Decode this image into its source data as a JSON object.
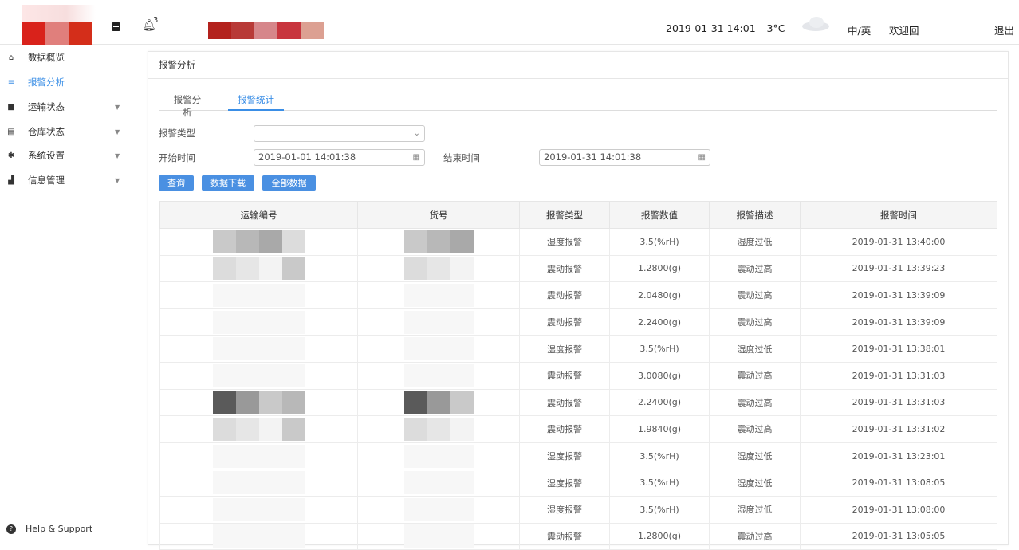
{
  "header": {
    "notification_count": "3",
    "datetime": "2019-01-31 14:01",
    "temperature": "-3°C",
    "lang_switch": "中/英",
    "welcome": "欢迎回",
    "logout": "退出"
  },
  "sidebar": {
    "items": [
      {
        "label": "数据概览",
        "icon": "home-icon",
        "glyph": "⌂",
        "active": false,
        "expandable": false
      },
      {
        "label": "报警分析",
        "icon": "list-icon",
        "glyph": "≡",
        "active": true,
        "expandable": false
      },
      {
        "label": "运输状态",
        "icon": "truck-icon",
        "glyph": "■",
        "active": false,
        "expandable": true
      },
      {
        "label": "仓库状态",
        "icon": "warehouse-icon",
        "glyph": "▤",
        "active": false,
        "expandable": true
      },
      {
        "label": "系统设置",
        "icon": "gear-icon",
        "glyph": "✱",
        "active": false,
        "expandable": true
      },
      {
        "label": "信息管理",
        "icon": "info-icon",
        "glyph": "▟",
        "active": false,
        "expandable": true
      }
    ],
    "help_label": "Help & Support"
  },
  "panel": {
    "title": "报警分析",
    "tabs": [
      {
        "label": "报警分析",
        "active": false
      },
      {
        "label": "报警统计",
        "active": true
      }
    ],
    "form": {
      "alarm_type_label": "报警类型",
      "alarm_type_value": "",
      "start_label": "开始时间",
      "start_value": "2019-01-01 14:01:38",
      "end_label": "结束时间",
      "end_value": "2019-01-31 14:01:38"
    },
    "buttons": {
      "query": "查询",
      "download": "数据下载",
      "all": "全部数据"
    },
    "table": {
      "columns": [
        "运输编号",
        "货号",
        "报警类型",
        "报警数值",
        "报警描述",
        "报警时间"
      ],
      "rows": [
        [
          "",
          "",
          "湿度报警",
          "3.5(%rH)",
          "湿度过低",
          "2019-01-31 13:40:00"
        ],
        [
          "",
          "",
          "震动报警",
          "1.2800(g)",
          "震动过高",
          "2019-01-31 13:39:23"
        ],
        [
          "",
          "",
          "震动报警",
          "2.0480(g)",
          "震动过高",
          "2019-01-31 13:39:09"
        ],
        [
          "",
          "",
          "震动报警",
          "2.2400(g)",
          "震动过高",
          "2019-01-31 13:39:09"
        ],
        [
          "",
          "",
          "湿度报警",
          "3.5(%rH)",
          "湿度过低",
          "2019-01-31 13:38:01"
        ],
        [
          "",
          "",
          "震动报警",
          "3.0080(g)",
          "震动过高",
          "2019-01-31 13:31:03"
        ],
        [
          "",
          "",
          "震动报警",
          "2.2400(g)",
          "震动过高",
          "2019-01-31 13:31:03"
        ],
        [
          "",
          "",
          "震动报警",
          "1.9840(g)",
          "震动过高",
          "2019-01-31 13:31:02"
        ],
        [
          "",
          "",
          "湿度报警",
          "3.5(%rH)",
          "湿度过低",
          "2019-01-31 13:23:01"
        ],
        [
          "",
          "",
          "湿度报警",
          "3.5(%rH)",
          "湿度过低",
          "2019-01-31 13:08:05"
        ],
        [
          "",
          "",
          "湿度报警",
          "3.5(%rH)",
          "湿度过低",
          "2019-01-31 13:08:00"
        ],
        [
          "",
          "",
          "震动报警",
          "1.2800(g)",
          "震动过高",
          "2019-01-31 13:05:05"
        ]
      ]
    }
  },
  "colors": {
    "accent": "#3a8ee6",
    "button": "#4a90e2",
    "logo": [
      "#d9221b",
      "#e07f7c",
      "#d42e1a"
    ],
    "banner": [
      "#b3221d",
      "#b83a37",
      "#d6868a",
      "#c8353e",
      "#dca092"
    ]
  }
}
